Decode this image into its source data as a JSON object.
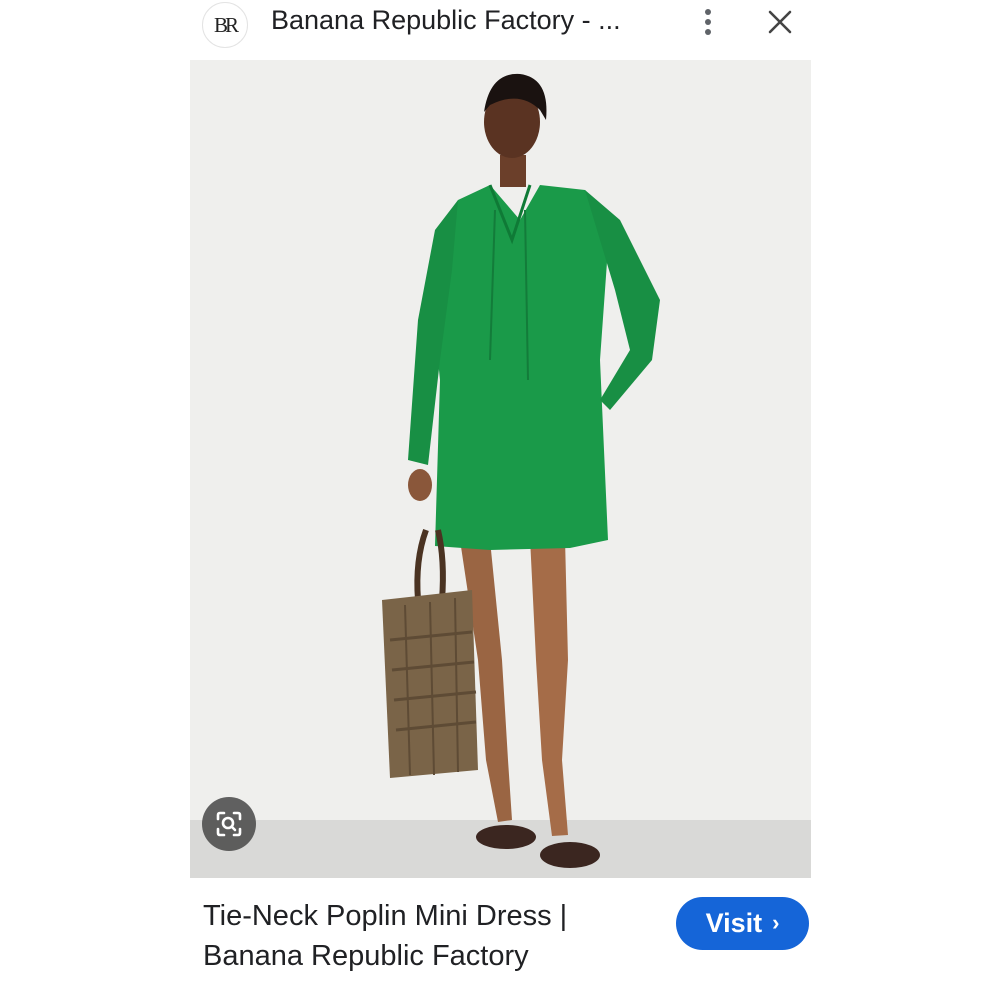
{
  "header": {
    "logo_text": "BR",
    "title": "Banana Republic Factory - ...",
    "more_icon": "more-vertical-icon",
    "close_icon": "close-icon"
  },
  "image": {
    "description_icon": "lens-icon",
    "colors": {
      "background": "#eeeeec",
      "dress": "#1a9a49",
      "bag": "#7a6448"
    }
  },
  "result": {
    "title": "Tie-Neck Poplin Mini Dress | Banana Republic Factory",
    "visit_label": "Visit",
    "visit_icon": "chevron-right-icon",
    "accent": "#1565d8"
  }
}
